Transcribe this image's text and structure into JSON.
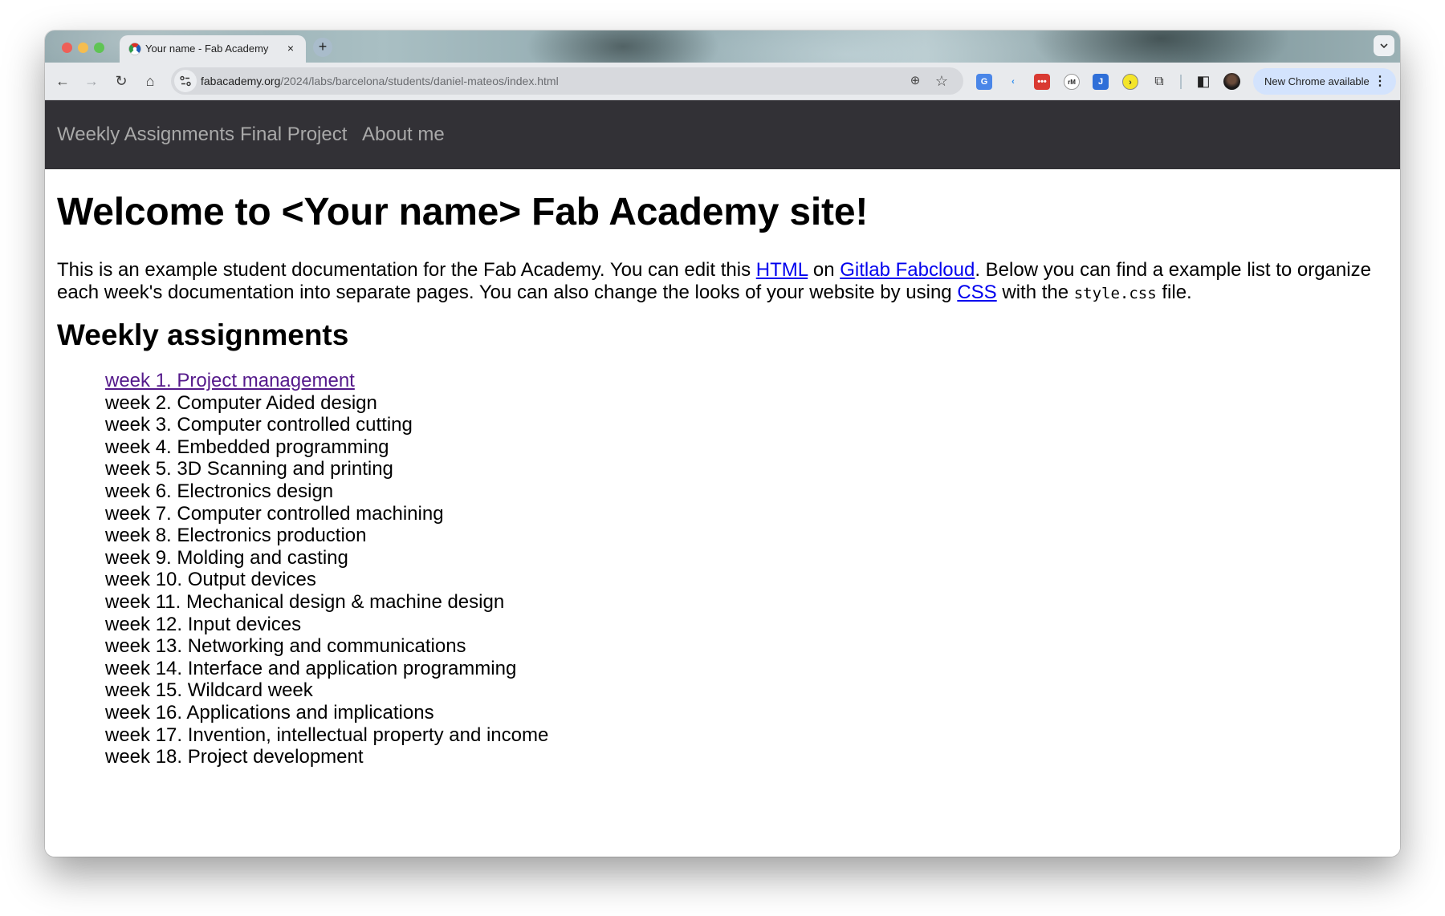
{
  "browser": {
    "tab": {
      "title": "Your name - Fab Academy",
      "close_label": "×"
    },
    "new_tab_label": "+",
    "tab_menu_label": "⌄",
    "nav": {
      "back_label": "←",
      "forward_label": "→",
      "reload_label": "↻",
      "home_label": "⌂"
    },
    "url": {
      "host": "fabacademy.org",
      "path": "/2024/labs/barcelona/students/daniel-mateos/index.html"
    },
    "omnibox_icons": {
      "zoom": "⊕",
      "bookmark": "☆"
    },
    "extensions": [
      {
        "name": "google-translate",
        "glyph": "G",
        "color": "#4a86e8",
        "fg": "#ffffff"
      },
      {
        "name": "c-extension",
        "glyph": "‹",
        "color": "#e8eaed",
        "fg": "#2a8cf0"
      },
      {
        "name": "red-extension",
        "glyph": "•••",
        "color": "#d93a32",
        "fg": "#ffffff"
      },
      {
        "name": "rm-extension",
        "glyph": "rM",
        "color": "#ffffff",
        "fg": "#222222"
      },
      {
        "name": "j-extension",
        "glyph": "J",
        "color": "#2f6fd8",
        "fg": "#ffffff"
      },
      {
        "name": "yellow-extension",
        "glyph": "›",
        "color": "#f4e52a",
        "fg": "#333333"
      },
      {
        "name": "extensions-puzzle",
        "glyph": "⧉",
        "color": "#e8eaed",
        "fg": "#333333"
      }
    ],
    "side_panel_label": "◧",
    "update_label": "New Chrome available",
    "menu_label": "⋮"
  },
  "site": {
    "nav": [
      {
        "label": "Weekly Assignments"
      },
      {
        "label": "Final Project"
      },
      {
        "label": "About me"
      }
    ],
    "heading": "Welcome to <Your name> Fab Academy site!",
    "intro": {
      "t1": "This is an example student documentation for the Fab Academy. You can edit this ",
      "link_html": "HTML",
      "t2": " on ",
      "link_gitlab": "Gitlab Fabcloud",
      "t3": ". Below you can find a example list to organize each week's documentation into separate pages. You can also change the looks of your website by using ",
      "link_css": "CSS",
      "t4": " with the ",
      "code": "style.css",
      "t5": " file."
    },
    "subheading": "Weekly assignments",
    "weeks": [
      "week 1. Project management",
      "week 2. Computer Aided design",
      "week 3. Computer controlled cutting",
      "week 4. Embedded programming",
      "week 5. 3D Scanning and printing",
      "week 6. Electronics design",
      "week 7. Computer controlled machining",
      "week 8. Electronics production",
      "week 9. Molding and casting",
      "week 10. Output devices",
      "week 11. Mechanical design & machine design",
      "week 12. Input devices",
      "week 13. Networking and communications",
      "week 14. Interface and application programming",
      "week 15. Wildcard week",
      "week 16. Applications and implications",
      "week 17. Invention, intellectual property and income",
      "week 18. Project development"
    ]
  },
  "colors": {
    "nav_bg": "#323136",
    "nav_text": "#a9a9a9",
    "link": "#0000ee",
    "visited_link": "#551a8b"
  }
}
